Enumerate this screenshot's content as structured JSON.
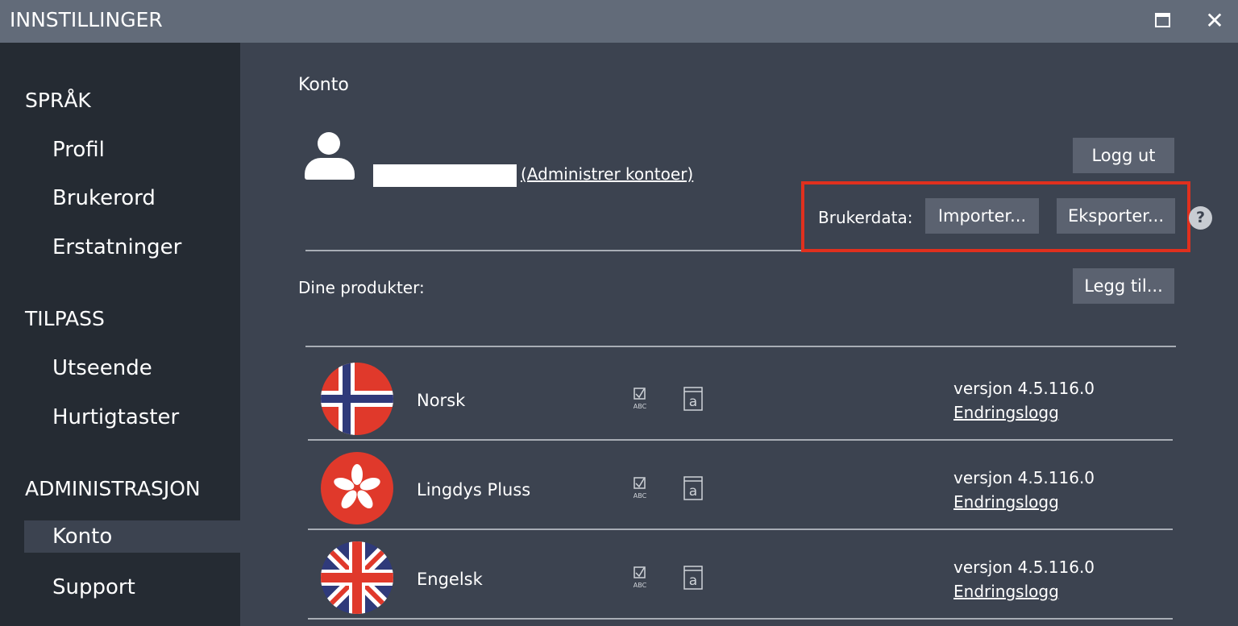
{
  "window": {
    "title": "INNSTILLINGER"
  },
  "sidebar": {
    "sections": [
      {
        "label": "SPRÅK",
        "items": [
          "Profil",
          "Brukerord",
          "Erstatninger"
        ]
      },
      {
        "label": "TILPASS",
        "items": [
          "Utseende",
          "Hurtigtaster"
        ]
      },
      {
        "label": "ADMINISTRASJON",
        "items": [
          "Konto",
          "Support"
        ]
      }
    ],
    "active": "Konto"
  },
  "account": {
    "heading": "Konto",
    "manage_link": "(Administrer kontoer)",
    "logout_label": "Logg ut",
    "userdata_label": "Brukerdata:",
    "import_label": "Importer...",
    "export_label": "Eksporter...",
    "help_glyph": "?"
  },
  "products": {
    "label": "Dine produkter:",
    "add_label": "Legg til...",
    "version_prefix": "versjon",
    "changelog_label": "Endringslogg",
    "items": [
      {
        "name": "Norsk",
        "version": "versjon   4.5.116.0",
        "changelog": "Endringslogg",
        "icon": "norway-flag-icon"
      },
      {
        "name": "Lingdys Pluss",
        "version": "versjon   4.5.116.0",
        "changelog": "Endringslogg",
        "icon": "lingdys-flower-icon"
      },
      {
        "name": "Engelsk",
        "version": "versjon   4.5.116.0",
        "changelog": "Endringslogg",
        "icon": "uk-flag-icon"
      }
    ]
  },
  "colors": {
    "titlebar": "#626b79",
    "sidebar": "#252b33",
    "main": "#3c4350",
    "button": "#5b6270",
    "highlight": "#e0301e",
    "flag_red": "#e0392b"
  }
}
